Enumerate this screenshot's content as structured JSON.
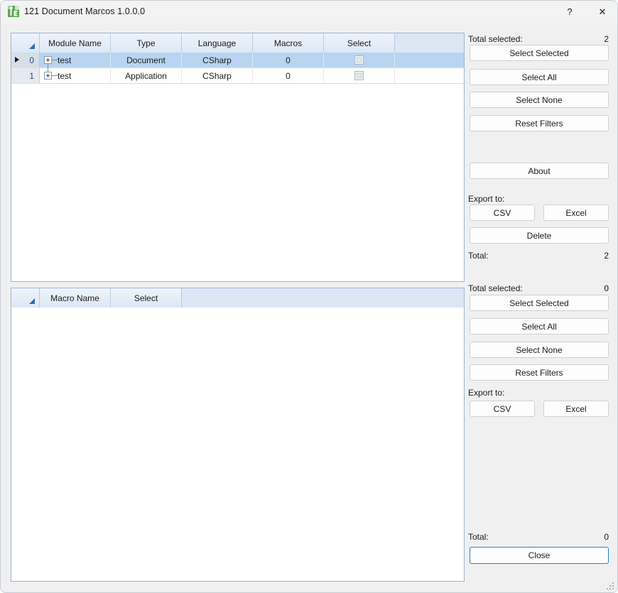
{
  "window": {
    "title": "121 Document Marcos 1.0.0.0",
    "icon": "app-icon-green",
    "help_label": "?",
    "close_label": "✕"
  },
  "module_grid": {
    "columns": [
      "Module Name",
      "Type",
      "Language",
      "Macros",
      "Select"
    ],
    "rows": [
      {
        "index": "0",
        "module_name": "test",
        "type": "Document",
        "language": "CSharp",
        "macros": "0",
        "select": false,
        "selected": true
      },
      {
        "index": "1",
        "module_name": "test",
        "type": "Application",
        "language": "CSharp",
        "macros": "0",
        "select": false,
        "selected": false
      }
    ]
  },
  "macro_grid": {
    "columns": [
      "Macro Name",
      "Select"
    ],
    "rows": []
  },
  "module_panel": {
    "total_selected_label": "Total selected:",
    "total_selected_value": "2",
    "select_selected_label": "Select Selected",
    "select_all_label": "Select All",
    "select_none_label": "Select None",
    "reset_filters_label": "Reset Filters",
    "about_label": "About",
    "export_to_label": "Export to:",
    "csv_label": "CSV",
    "excel_label": "Excel",
    "delete_label": "Delete",
    "total_label": "Total:",
    "total_value": "2"
  },
  "macro_panel": {
    "total_selected_label": "Total selected:",
    "total_selected_value": "0",
    "select_selected_label": "Select Selected",
    "select_all_label": "Select All",
    "select_none_label": "Select None",
    "reset_filters_label": "Reset Filters",
    "export_to_label": "Export to:",
    "csv_label": "CSV",
    "excel_label": "Excel",
    "total_label": "Total:",
    "total_value": "0",
    "close_label": "Close"
  },
  "colors": {
    "window_bg": "#f0f0f0",
    "grid_border": "#9ab3d5",
    "header_bg": "#dfe7f3",
    "row_selected": "#b8d4f1",
    "accent_blue": "#2e7dd1",
    "icon_green": "#4a9b3f"
  }
}
